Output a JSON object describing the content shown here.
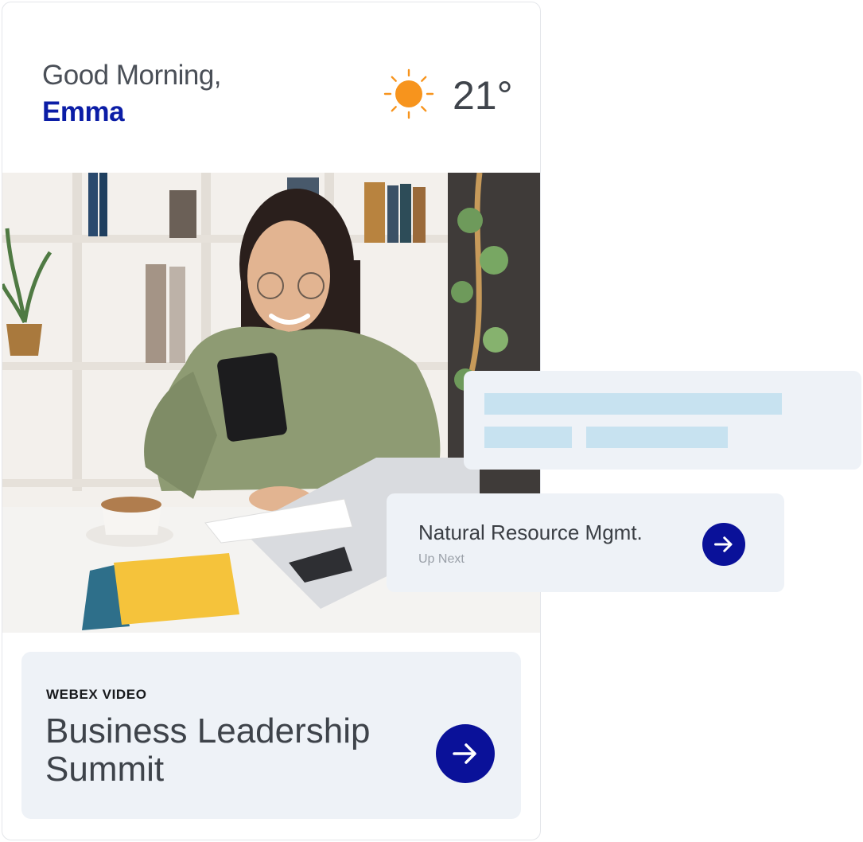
{
  "header": {
    "greeting": "Good Morning,",
    "name": "Emma",
    "temperature": "21°",
    "weather_icon": "sun-icon"
  },
  "featured": {
    "kicker": "WEBEX VIDEO",
    "title": "Business Leadership Summit",
    "action_icon": "arrow-right-icon"
  },
  "up_next": {
    "title": "Natural Resource Mgmt.",
    "subtitle": "Up Next",
    "action_icon": "arrow-right-icon"
  },
  "colors": {
    "accent": "#0a1199",
    "name_blue": "#0b1da6",
    "sun": "#f7941d",
    "panel_bg": "#eef2f7",
    "skeleton_bar": "#c7e2f0"
  }
}
